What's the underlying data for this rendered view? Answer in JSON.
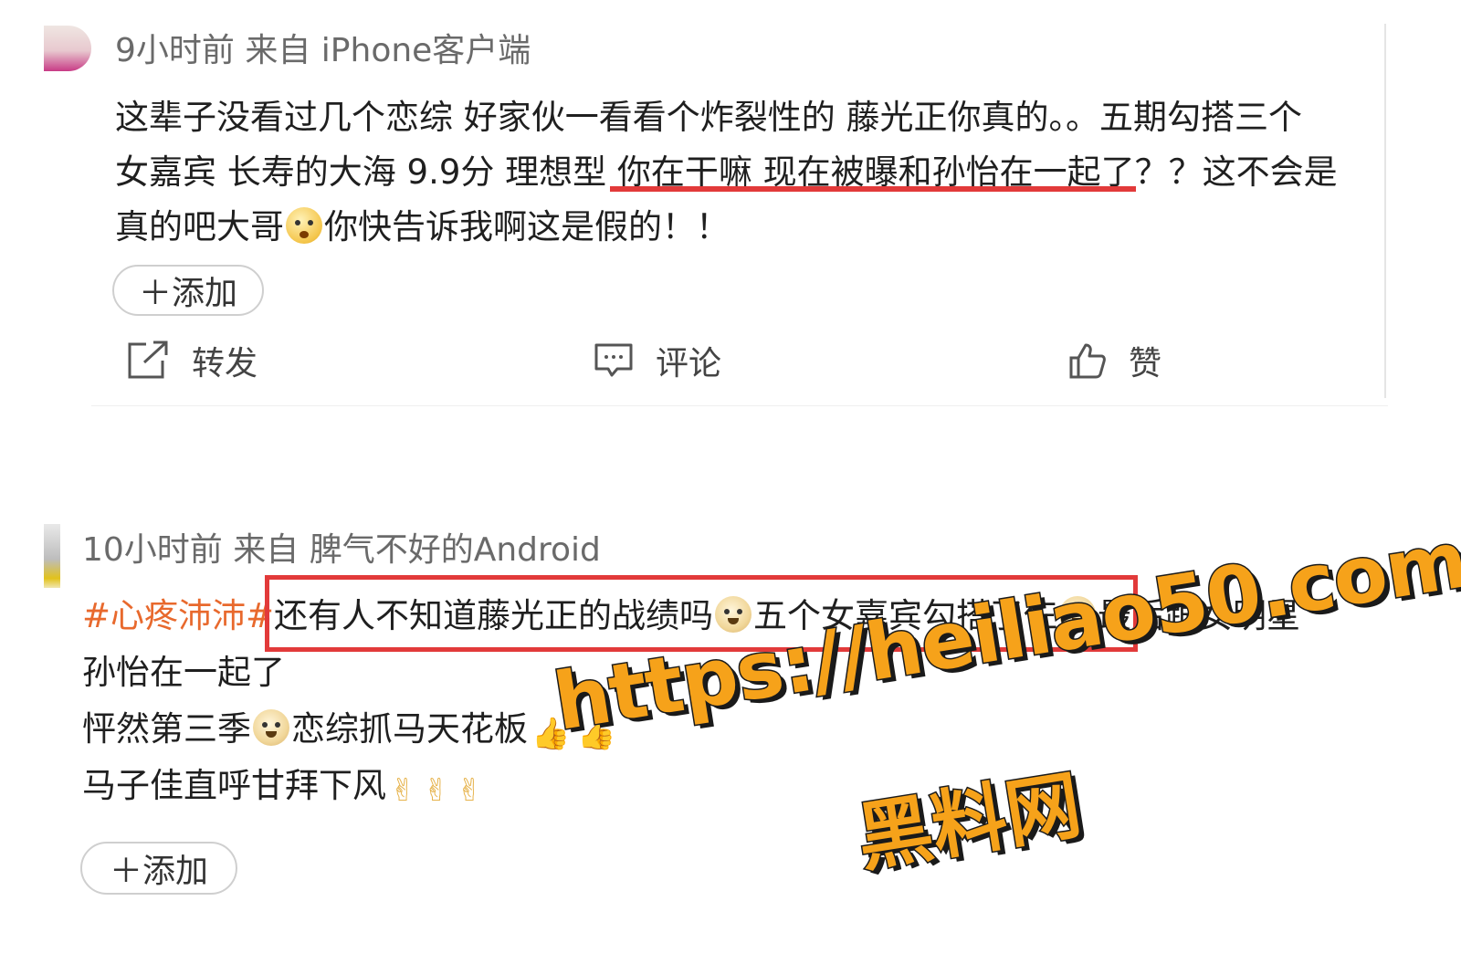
{
  "post1": {
    "meta": "9小时前 来自 iPhone客户端",
    "lines": [
      "这辈子没看过几个恋综 好家伙一看看个炸裂性的 藤光正你真的。。五期勾搭三个",
      "女嘉宾 长寿的大海 9.9分 理想型 你在干嘛 现在被曝和孙怡在一起了？？这不会是",
      [
        "真的吧大哥",
        "你快告诉我啊这是假的！！"
      ]
    ],
    "add_label": "＋添加",
    "actions": {
      "share": "转发",
      "comment": "评论",
      "like": "赞"
    }
  },
  "post2": {
    "meta": "10小时前 来自 脾气不好的Android",
    "topic": "#心疼沛沛#",
    "line1_a": "还有人不知道藤光正的战绩吗",
    "line1_b": "五个女嘉宾勾搭了仨",
    "line1_c": "最后跟女明星",
    "line2": "孙怡在一起了",
    "line3_a": "怦然第三季",
    "line3_b": "恋综抓马天花板",
    "line4": "马子佳直呼甘拜下风",
    "add_label": "＋添加"
  },
  "watermark": {
    "url": "https://heiliao50.com",
    "name": "黑料网"
  },
  "colors": {
    "highlight_red": "#e23a3a",
    "topic_orange": "#e8692d",
    "watermark_orange": "#f6a21a"
  }
}
